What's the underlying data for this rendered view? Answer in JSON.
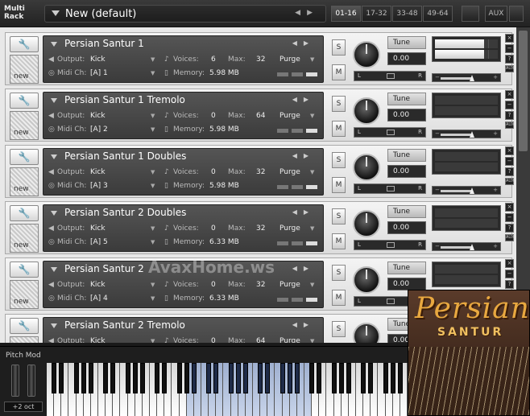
{
  "header": {
    "rack_label_line1": "Multi",
    "rack_label_line2": "Rack",
    "preset_name": "New (default)",
    "prev_arrow": "◀",
    "next_arrow": "▶",
    "pages": [
      "01-16",
      "17-32",
      "33-48",
      "49-64"
    ],
    "active_page": "01-16",
    "aux_label": "AUX"
  },
  "slot_labels": {
    "output": "Output:",
    "midi": "Midi Ch:",
    "voices": "Voices:",
    "max": "Max:",
    "memory": "Memory:",
    "purge": "Purge",
    "tune": "Tune",
    "solo": "S",
    "mute": "M",
    "new": "new",
    "pan_left": "L",
    "pan_right": "R",
    "aux_short": "AUX",
    "close": "×",
    "minus": "−",
    "question": "?"
  },
  "instruments": [
    {
      "name": "Persian Santur 1",
      "output": "Kick",
      "midi": "[A]  1",
      "voices": "6",
      "max": "32",
      "memory": "5.98 MB",
      "tune": "0.00"
    },
    {
      "name": "Persian Santur 1 Tremolo",
      "output": "Kick",
      "midi": "[A]  2",
      "voices": "0",
      "max": "64",
      "memory": "5.98 MB",
      "tune": "0.00"
    },
    {
      "name": "Persian Santur 1 Doubles",
      "output": "Kick",
      "midi": "[A]  3",
      "voices": "0",
      "max": "32",
      "memory": "5.98 MB",
      "tune": "0.00"
    },
    {
      "name": "Persian Santur 2 Doubles",
      "output": "Kick",
      "midi": "[A]  5",
      "voices": "0",
      "max": "32",
      "memory": "6.33 MB",
      "tune": "0.00"
    },
    {
      "name": "Persian Santur 2",
      "output": "Kick",
      "midi": "[A]  4",
      "voices": "0",
      "max": "32",
      "memory": "6.33 MB",
      "tune": "0.00"
    },
    {
      "name": "Persian Santur 2 Tremolo",
      "output": "Kick",
      "midi": "",
      "voices": "0",
      "max": "64",
      "memory": "",
      "tune": "0.00"
    }
  ],
  "keyboard": {
    "pitch_mod_label": "Pitch Mod",
    "octave": "+2 oct"
  },
  "logo": {
    "word1": "Persian",
    "word2": "SANTUR"
  },
  "watermark": "AvaxHome.ws",
  "colors": {
    "accent_key": "#9fb0d0",
    "logo_text": "#e8a840"
  }
}
